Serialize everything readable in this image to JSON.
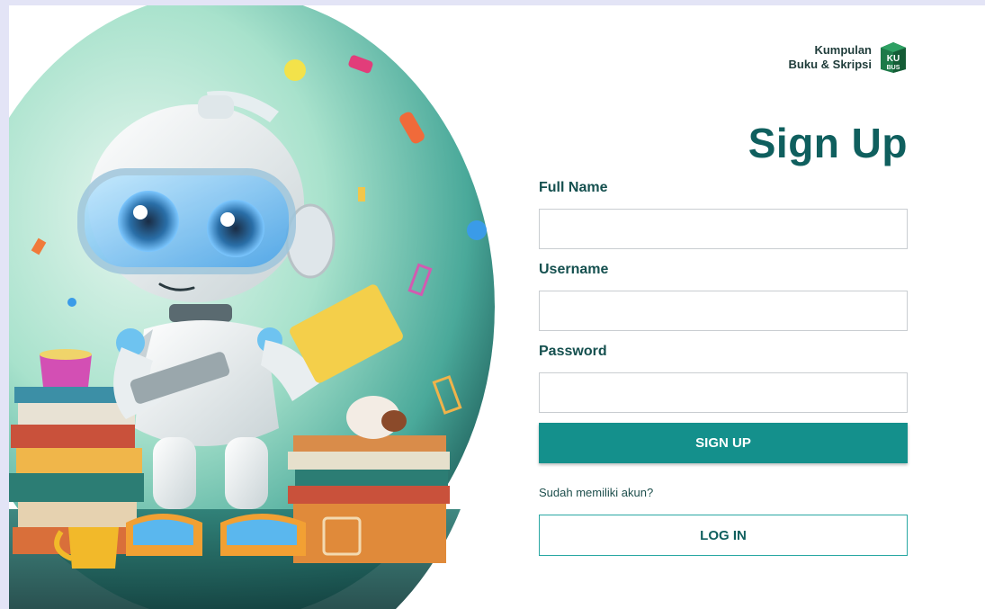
{
  "brand": {
    "line1": "Kumpulan",
    "line2": "Buku & Skripsi",
    "logo_top": "KU",
    "logo_bottom": "BUS"
  },
  "form": {
    "title": "Sign Up",
    "fields": [
      {
        "label": "Full Name",
        "value": "",
        "placeholder": ""
      },
      {
        "label": "Username",
        "value": "",
        "placeholder": ""
      },
      {
        "label": "Password",
        "value": "",
        "placeholder": ""
      }
    ],
    "signup_label": "SIGN UP",
    "already_text": "Sudah memiliki akun?",
    "login_label": "LOG IN"
  },
  "colors": {
    "primary": "#14908c",
    "title": "#0f5f5e",
    "frame": "#e3e4f6"
  }
}
